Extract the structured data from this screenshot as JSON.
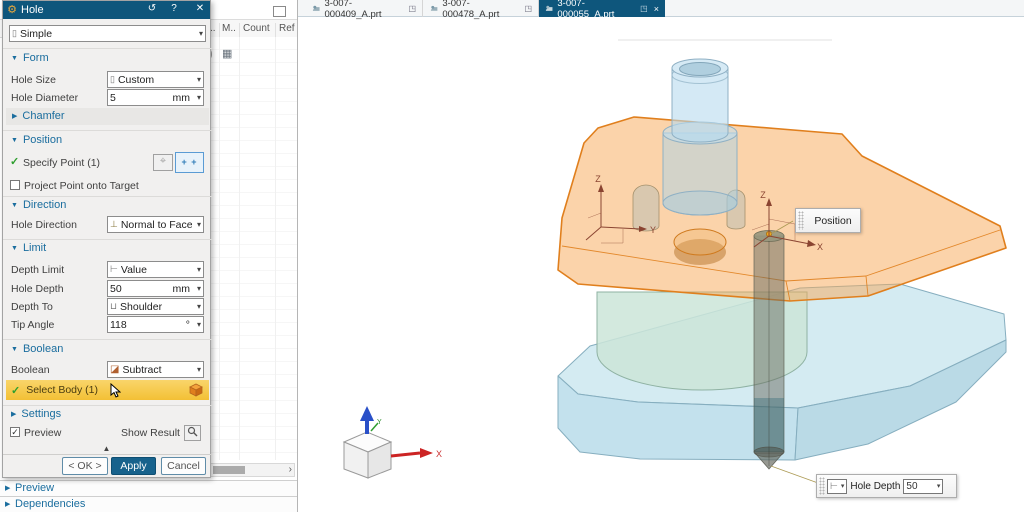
{
  "dialog": {
    "title": "Hole",
    "titlebar": {
      "reset_glyph": "↺",
      "help_glyph": "?",
      "close_glyph": "✕"
    },
    "type": {
      "value": "Simple"
    },
    "form": {
      "header": "Form",
      "hole_size_label": "Hole Size",
      "hole_size_value": "Custom",
      "hole_diameter_label": "Hole Diameter",
      "hole_diameter_value": "5",
      "hole_diameter_unit": "mm",
      "chamfer_label": "Chamfer"
    },
    "position": {
      "header": "Position",
      "specify_point": "Specify Point (1)",
      "project_point": "Project Point onto Target"
    },
    "direction": {
      "header": "Direction",
      "hole_direction_label": "Hole Direction",
      "hole_direction_value": "Normal to Face"
    },
    "limit": {
      "header": "Limit",
      "depth_limit_label": "Depth Limit",
      "depth_limit_value": "Value",
      "hole_depth_label": "Hole Depth",
      "hole_depth_value": "50",
      "hole_depth_unit": "mm",
      "depth_to_label": "Depth To",
      "depth_to_value": "Shoulder",
      "tip_angle_label": "Tip Angle",
      "tip_angle_value": "118",
      "tip_angle_unit": "°"
    },
    "boolean": {
      "header": "Boolean",
      "boolean_label": "Boolean",
      "boolean_value": "Subtract",
      "select_body": "Select Body (1)"
    },
    "settings": {
      "header": "Settings"
    },
    "footer": {
      "preview_label": "Preview",
      "show_result_label": "Show Result",
      "ok": "< OK >",
      "apply": "Apply",
      "cancel": "Cancel"
    }
  },
  "navigator": {
    "columns": [
      "..",
      "M..",
      "Count",
      "Ref"
    ],
    "bottom_sections": [
      {
        "label": "Preview"
      },
      {
        "label": "Dependencies"
      }
    ]
  },
  "tabs": [
    {
      "label": "3-007-000409_A.prt",
      "active": false
    },
    {
      "label": "3-007-000478_A.prt",
      "active": false
    },
    {
      "label": "3-007-000055_A.prt",
      "active": true
    }
  ],
  "viewport": {
    "position_label": "Position",
    "hole_depth_label": "Hole Depth",
    "hole_depth_value": "50",
    "triad_plate": {
      "z": "Z",
      "y": "Y"
    },
    "triad_hole": {
      "z": "Z",
      "x": "X"
    },
    "wcs": {
      "x": "X",
      "y": "Y"
    }
  },
  "colors": {
    "accent": "#0e567c",
    "selection_highlight": "#f6c844",
    "selected_body_orange": "#e8882a",
    "preview_blue": "#b7dbee",
    "base_cyan": "#c9e4ee",
    "success_green": "#2e9e2e"
  }
}
